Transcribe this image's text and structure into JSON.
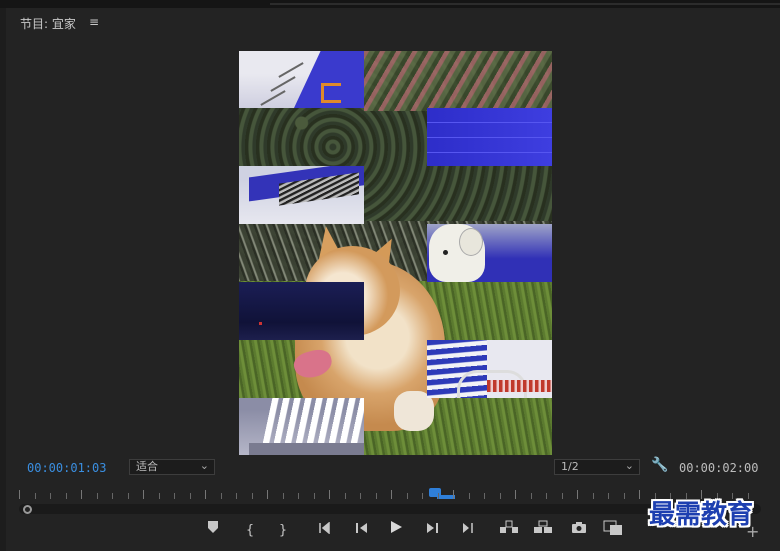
{
  "panel": {
    "title": "节目: 宜家",
    "menu_icon": "≡"
  },
  "timecode": {
    "current": "00:00:01:03",
    "duration": "00:00:02:00"
  },
  "fit_dropdown": {
    "value": "适合"
  },
  "resolution_dropdown": {
    "value": "1/2"
  },
  "playhead_position_fraction": 0.56,
  "controls": [
    {
      "name": "add-marker-button",
      "icon": "marker"
    },
    {
      "name": "mark-in-button",
      "icon": "mark-in"
    },
    {
      "name": "mark-out-button",
      "icon": "mark-out"
    },
    {
      "name": "go-to-in-button",
      "icon": "go-to-in"
    },
    {
      "name": "step-back-button",
      "icon": "step-back"
    },
    {
      "name": "play-button",
      "icon": "play"
    },
    {
      "name": "step-forward-button",
      "icon": "step-forward"
    },
    {
      "name": "go-to-out-button",
      "icon": "go-to-out"
    },
    {
      "name": "lift-button",
      "icon": "lift"
    },
    {
      "name": "extract-button",
      "icon": "extract"
    },
    {
      "name": "export-frame-button",
      "icon": "camera"
    },
    {
      "name": "comparison-view-button",
      "icon": "compare"
    }
  ],
  "watermark": {
    "text": "最需教育"
  },
  "colors": {
    "timecode_accent": "#3a8ee0",
    "playhead": "#2f7fd9",
    "panel_bg": "#232323"
  }
}
